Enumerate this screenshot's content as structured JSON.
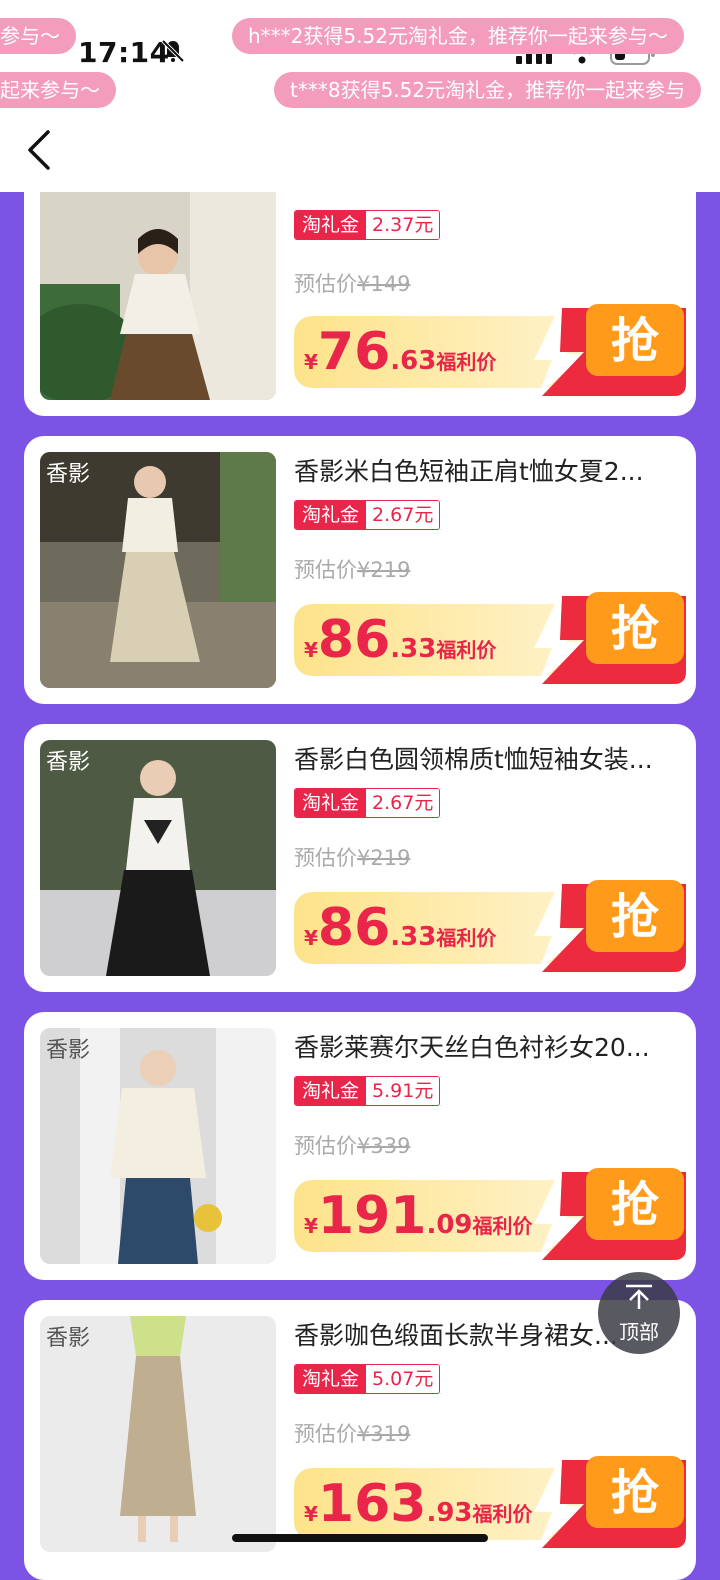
{
  "status_bar": {
    "time": "17:14"
  },
  "ticker": [
    "参与～",
    "h***2获得5.52元淘礼金，推荐你一起来参与～",
    "起来参与～",
    "t***8获得5.52元淘礼金，推荐你一起来参与"
  ],
  "products": [
    {
      "brand": "",
      "title": "",
      "coupon_label": "淘礼金",
      "coupon_value": "2.37元",
      "est_label": "预估价",
      "est_price": "¥149",
      "currency": "¥",
      "price_int": "76",
      "price_dec": ".63",
      "price_label": "福利价",
      "grab_label": "抢"
    },
    {
      "brand": "香影",
      "title": "香影米白色短袖正肩t恤女夏2...",
      "coupon_label": "淘礼金",
      "coupon_value": "2.67元",
      "est_label": "预估价",
      "est_price": "¥219",
      "currency": "¥",
      "price_int": "86",
      "price_dec": ".33",
      "price_label": "福利价",
      "grab_label": "抢"
    },
    {
      "brand": "香影",
      "title": "香影白色圆领棉质t恤短袖女装...",
      "coupon_label": "淘礼金",
      "coupon_value": "2.67元",
      "est_label": "预估价",
      "est_price": "¥219",
      "currency": "¥",
      "price_int": "86",
      "price_dec": ".33",
      "price_label": "福利价",
      "grab_label": "抢"
    },
    {
      "brand": "香影",
      "title": "香影莱赛尔天丝白色衬衫女20...",
      "coupon_label": "淘礼金",
      "coupon_value": "5.91元",
      "est_label": "预估价",
      "est_price": "¥339",
      "currency": "¥",
      "price_int": "191",
      "price_dec": ".09",
      "price_label": "福利价",
      "grab_label": "抢"
    },
    {
      "brand": "香影",
      "title": "香影咖色缎面长款半身裙女...",
      "coupon_label": "淘礼金",
      "coupon_value": "5.07元",
      "est_label": "预估价",
      "est_price": "¥319",
      "currency": "¥",
      "price_int": "163",
      "price_dec": ".93",
      "price_label": "福利价",
      "grab_label": "抢"
    }
  ],
  "back_to_top": {
    "label": "顶部"
  },
  "colors": {
    "background": "#7b54e6",
    "accent": "#e9254a",
    "ticker": "#f39cbc",
    "price_bar": "#fde9a6",
    "grab_button": "#ff9a1a"
  }
}
